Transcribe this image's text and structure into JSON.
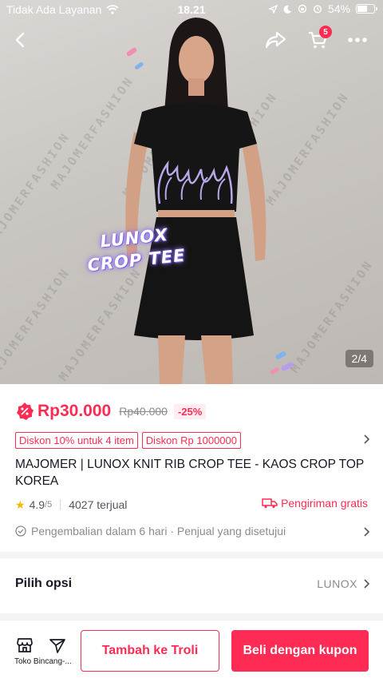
{
  "status_bar": {
    "carrier": "Tidak Ada Layanan",
    "time": "18.21",
    "battery": "54%",
    "battery_level": 0.54
  },
  "product_image": {
    "watermark": "MAJOMERFASHION",
    "overlay_line1": "LUNOX",
    "overlay_line2": "CROP TEE",
    "counter": "2/4"
  },
  "nav": {
    "back_icon": "chevron-left-icon",
    "share_icon": "share-icon",
    "cart_icon": "cart-icon",
    "cart_count": "5",
    "more_icon": "more-icon"
  },
  "price": {
    "current": "Rp30.000",
    "original": "Rp40.000",
    "discount": "-25%"
  },
  "coupons": [
    "Diskon 10% untuk 4 item",
    "Diskon Rp 1000000"
  ],
  "product": {
    "title": "MAJOMER  | LUNOX KNIT RIB CROP TEE - KAOS CROP TOP KOREA",
    "rating": "4.9",
    "rating_max": "/5",
    "sold": "4027 terjual",
    "shipping": "Pengiriman gratis",
    "return_policy": "Pengembalian dalam 6 hari · Penjual yang disetujui"
  },
  "options": {
    "label": "Pilih opsi",
    "value": "LUNOX"
  },
  "bottom_bar": {
    "shop_label": "Toko Bincang-...",
    "add_to_cart": "Tambah ke Troli",
    "buy_now": "Beli dengan kupon"
  },
  "colors": {
    "accent": "#fe2c55",
    "text": "#161823",
    "muted": "#8a8b91",
    "star": "#f5b700"
  }
}
